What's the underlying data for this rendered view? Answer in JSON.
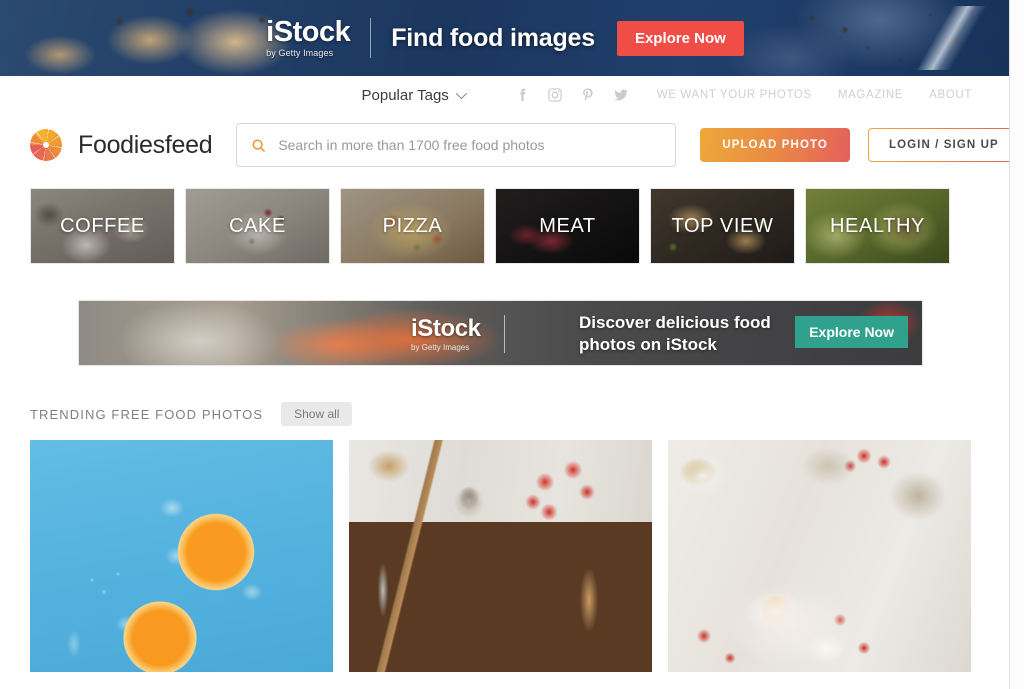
{
  "top_banner": {
    "brand": "iStock",
    "brand_sub": "by Getty Images",
    "headline": "Find food images",
    "cta": "Explore Now",
    "cta_color": "#ef4d45"
  },
  "utility_nav": {
    "popular_tags": "Popular Tags",
    "dropdown_icon": "chevron-down-icon",
    "social": [
      {
        "name": "facebook-icon",
        "label": "Facebook"
      },
      {
        "name": "instagram-icon",
        "label": "Instagram"
      },
      {
        "name": "pinterest-icon",
        "label": "Pinterest"
      },
      {
        "name": "twitter-icon",
        "label": "Twitter"
      }
    ],
    "links": [
      {
        "label": "WE WANT YOUR PHOTOS"
      },
      {
        "label": "MAGAZINE"
      },
      {
        "label": "ABOUT"
      }
    ]
  },
  "header": {
    "logo_icon": "aperture-logo-icon",
    "brand_name": "Foodiesfeed",
    "search": {
      "icon": "search-icon",
      "placeholder": "Search in more than 1700 free food photos",
      "value": ""
    },
    "upload_label": "UPLOAD PHOTO",
    "login_label": "LOGIN / SIGN UP",
    "accent_start": "#eda83a",
    "accent_end": "#e4605c"
  },
  "categories": [
    {
      "label": "COFFEE",
      "css": "t-coffee"
    },
    {
      "label": "CAKE",
      "css": "t-cake"
    },
    {
      "label": "PIZZA",
      "css": "t-pizza"
    },
    {
      "label": "MEAT",
      "css": "t-meat"
    },
    {
      "label": "TOP VIEW",
      "css": "t-topview"
    },
    {
      "label": "HEALTHY",
      "css": "t-healthy"
    }
  ],
  "mid_banner": {
    "brand": "iStock",
    "brand_sub": "by Getty Images",
    "line1": "Discover delicious food",
    "line2": "photos on iStock",
    "cta": "Explore Now",
    "cta_color": "#2fa18c"
  },
  "trending": {
    "title": "TRENDING FREE FOOD PHOTOS",
    "show_all": "Show all"
  },
  "photos": [
    {
      "alt": "orange halves with ice cubes on blue background",
      "css": "ph-oranges"
    },
    {
      "alt": "burgers on wooden tray with tomatoes and knife",
      "css": "ph-burger"
    },
    {
      "alt": "fried egg on toast with tomatoes and tea",
      "css": "ph-egg"
    }
  ]
}
